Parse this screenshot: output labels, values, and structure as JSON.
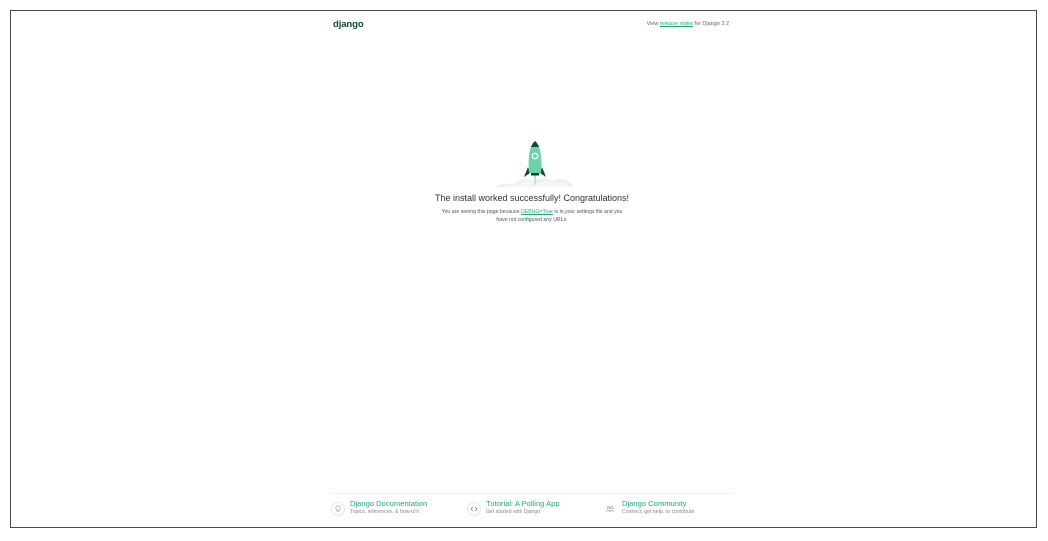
{
  "header": {
    "logo": "django",
    "release_prefix": "View ",
    "release_link": "release notes",
    "release_suffix": " for Django 3.2"
  },
  "hero": {
    "title": "The install worked successfully! Congratulations!",
    "desc_prefix": "You are seeing this page because ",
    "desc_link": "DEBUG=True",
    "desc_suffix": " is in your settings file and you have not configured any URLs."
  },
  "footer": {
    "items": [
      {
        "title": "Django Documentation",
        "subtitle": "Topics, references, & how-to's",
        "icon": "lightbulb-icon"
      },
      {
        "title": "Tutorial: A Polling App",
        "subtitle": "Get started with Django",
        "icon": "code-brackets-icon"
      },
      {
        "title": "Django Community",
        "subtitle": "Connect, get help, or contribute",
        "icon": "community-icon"
      }
    ]
  },
  "colors": {
    "brand_dark": "#0c4b33",
    "accent": "#20aa76",
    "rocket": "#6dd1a9"
  }
}
